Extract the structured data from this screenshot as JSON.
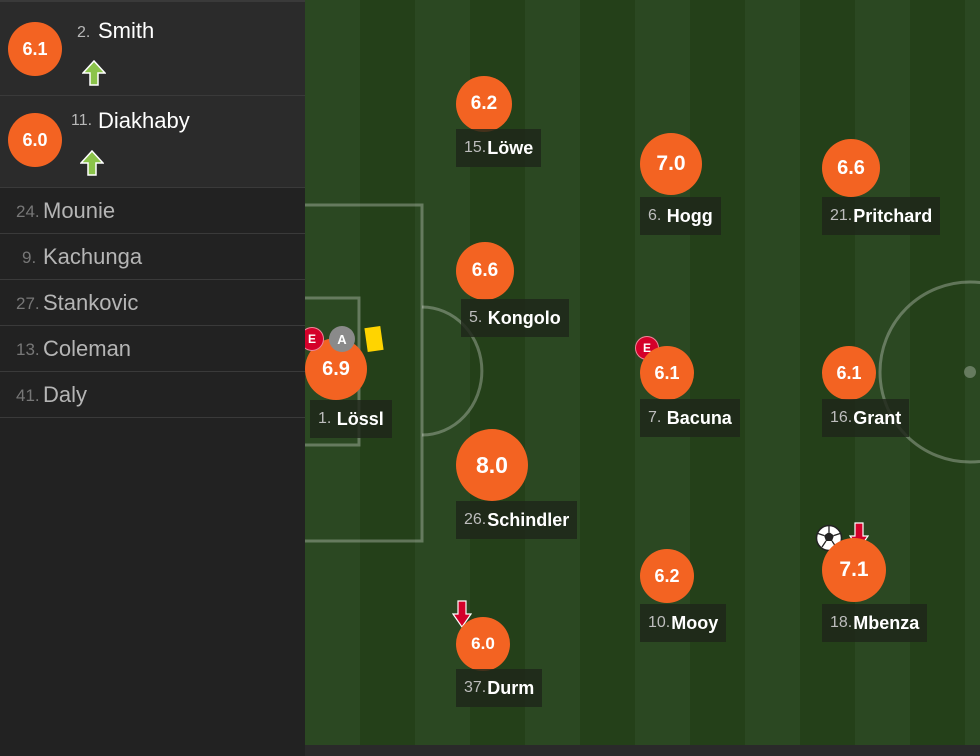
{
  "substitutes_in": [
    {
      "rating": "6.1",
      "number": "2.",
      "name": "Smith",
      "status": "subbed-in"
    },
    {
      "rating": "6.0",
      "number": "11.",
      "name": "Diakhaby",
      "status": "subbed-in"
    }
  ],
  "bench": [
    {
      "number": "24.",
      "name": "Mounie"
    },
    {
      "number": "9.",
      "name": "Kachunga"
    },
    {
      "number": "27.",
      "name": "Stankovic"
    },
    {
      "number": "13.",
      "name": "Coleman"
    },
    {
      "number": "41.",
      "name": "Daly"
    }
  ],
  "pitch_players": [
    {
      "number": "1.",
      "name": "Lössl",
      "rating": "6.9"
    },
    {
      "number": "15.",
      "name": "Löwe",
      "rating": "6.2"
    },
    {
      "number": "5.",
      "name": "Kongolo",
      "rating": "6.6"
    },
    {
      "number": "26.",
      "name": "Schindler",
      "rating": "8.0"
    },
    {
      "number": "37.",
      "name": "Durm",
      "rating": "6.0"
    },
    {
      "number": "6.",
      "name": "Hogg",
      "rating": "7.0"
    },
    {
      "number": "7.",
      "name": "Bacuna",
      "rating": "6.1"
    },
    {
      "number": "10.",
      "name": "Mooy",
      "rating": "6.2"
    },
    {
      "number": "21.",
      "name": "Pritchard",
      "rating": "6.6"
    },
    {
      "number": "16.",
      "name": "Grant",
      "rating": "6.1"
    },
    {
      "number": "18.",
      "name": "Mbenza",
      "rating": "7.1"
    }
  ],
  "badges": {
    "error": "E",
    "assist": "A"
  },
  "icons": {
    "up_arrow": "up-arrow-icon",
    "down_arrow": "down-arrow-icon",
    "ball": "soccer-ball-icon",
    "yellow_card": "yellow-card-icon"
  },
  "colors": {
    "rating_bg": "#f36322",
    "highlight_rating_bg": "#f36322",
    "error_badge": "#d4002a",
    "yellow_card": "#ffd400",
    "arrow_up": "#8bc34a",
    "arrow_down": "#d4002a"
  }
}
